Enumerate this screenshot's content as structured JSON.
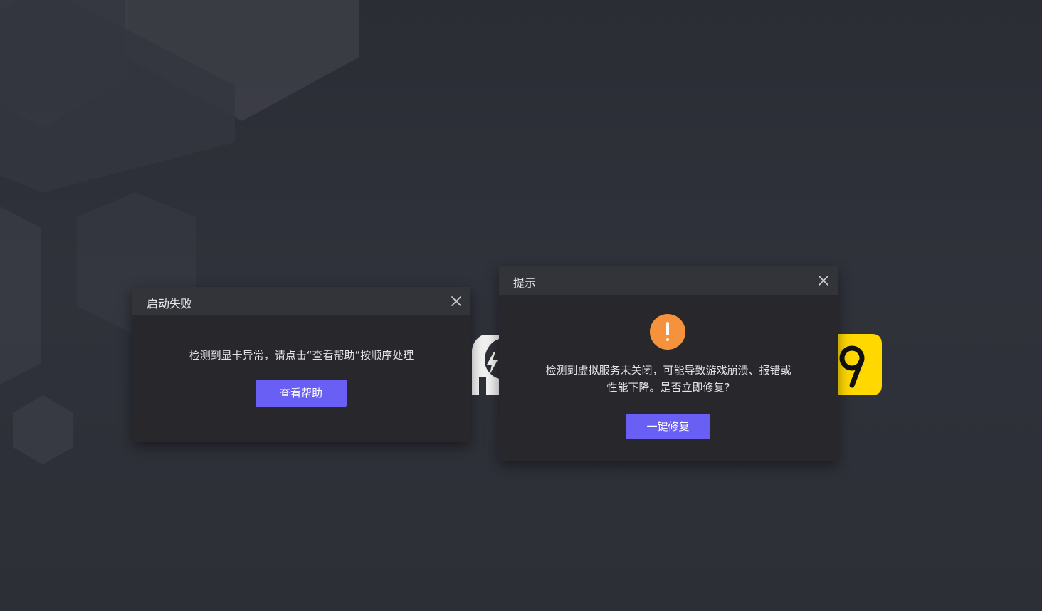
{
  "dialog_launch_failed": {
    "title": "启动失败",
    "message": "检测到显卡异常，请点击“查看帮助”按顺序处理",
    "button_label": "查看帮助"
  },
  "dialog_hint": {
    "title": "提示",
    "message": "检测到虚拟服务未关闭，可能导致游戏崩溃、报错或性能下降。是否立即修复?",
    "button_label": "一键修复"
  },
  "icons": {
    "close": "close-icon",
    "warning": "warning-icon",
    "background_app_left": "lightning-bolt-icon",
    "background_app_right": "nine-icon"
  },
  "colors": {
    "background": "#2f3139",
    "dialog_bg": "#27272c",
    "dialog_header_bg": "#333439",
    "primary_button": "#6a5ff5",
    "warning": "#f6923b",
    "app_icon_yellow": "#ffd800"
  }
}
